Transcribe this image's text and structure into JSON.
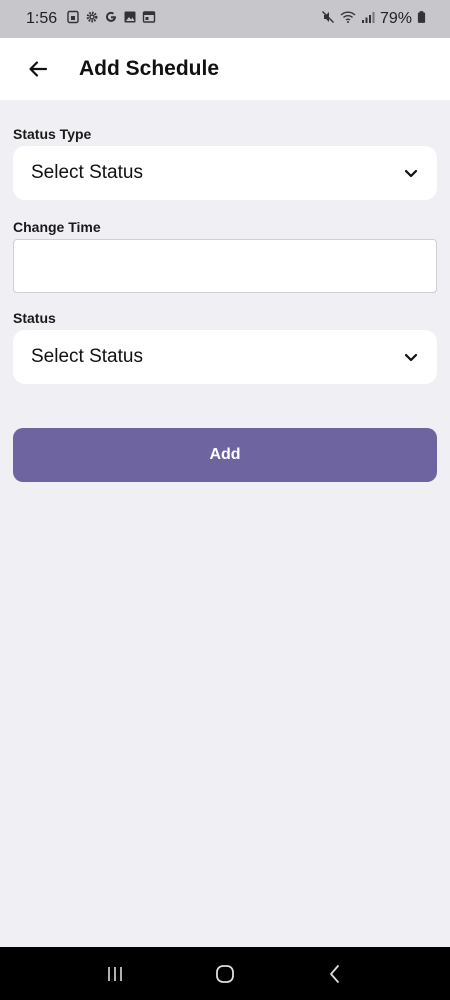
{
  "status_bar": {
    "time": "1:56",
    "battery": "79%",
    "left_icons": [
      "sim-card-icon",
      "settings-gear-icon",
      "google-icon",
      "image-icon",
      "calendar-icon"
    ],
    "right_icons": [
      "mute-icon",
      "wifi-icon",
      "signal-icon",
      "battery-icon"
    ]
  },
  "header": {
    "title": "Add Schedule",
    "back_icon": "arrow-left-icon"
  },
  "form": {
    "status_type": {
      "label": "Status Type",
      "value": "Select Status"
    },
    "change_time": {
      "label": "Change Time",
      "value": ""
    },
    "status": {
      "label": "Status",
      "value": "Select Status"
    },
    "submit_label": "Add"
  },
  "colors": {
    "accent": "#6e64a0",
    "background": "#f0eff4",
    "surface": "#ffffff"
  },
  "nav_bar": {
    "icons": [
      "recent-apps-icon",
      "home-icon",
      "back-icon"
    ]
  }
}
